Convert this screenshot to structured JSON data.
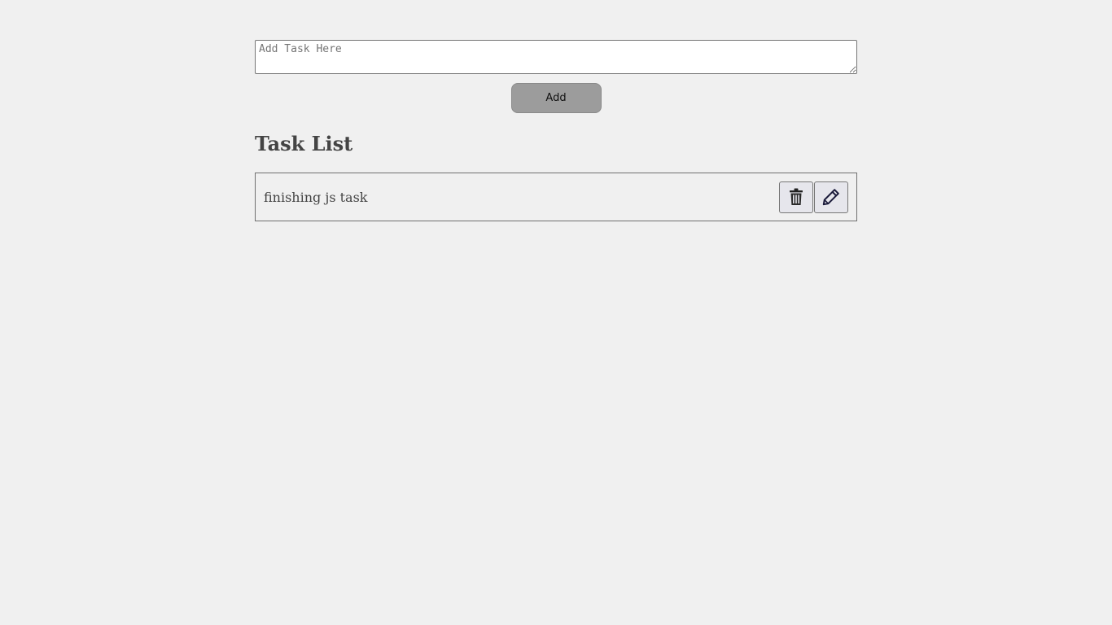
{
  "form": {
    "input_placeholder": "Add Task Here",
    "input_value": "",
    "add_label": "Add"
  },
  "task_list": {
    "title": "Task List",
    "items": [
      {
        "text": "finishing js task",
        "delete_icon": "trash-icon",
        "edit_icon": "pencil-icon"
      }
    ]
  },
  "colors": {
    "background": "#f0f0f0",
    "add_button": "#9c9c9c",
    "icon_button": "#e6e6ec",
    "edit_icon": "#1a1a3a"
  }
}
